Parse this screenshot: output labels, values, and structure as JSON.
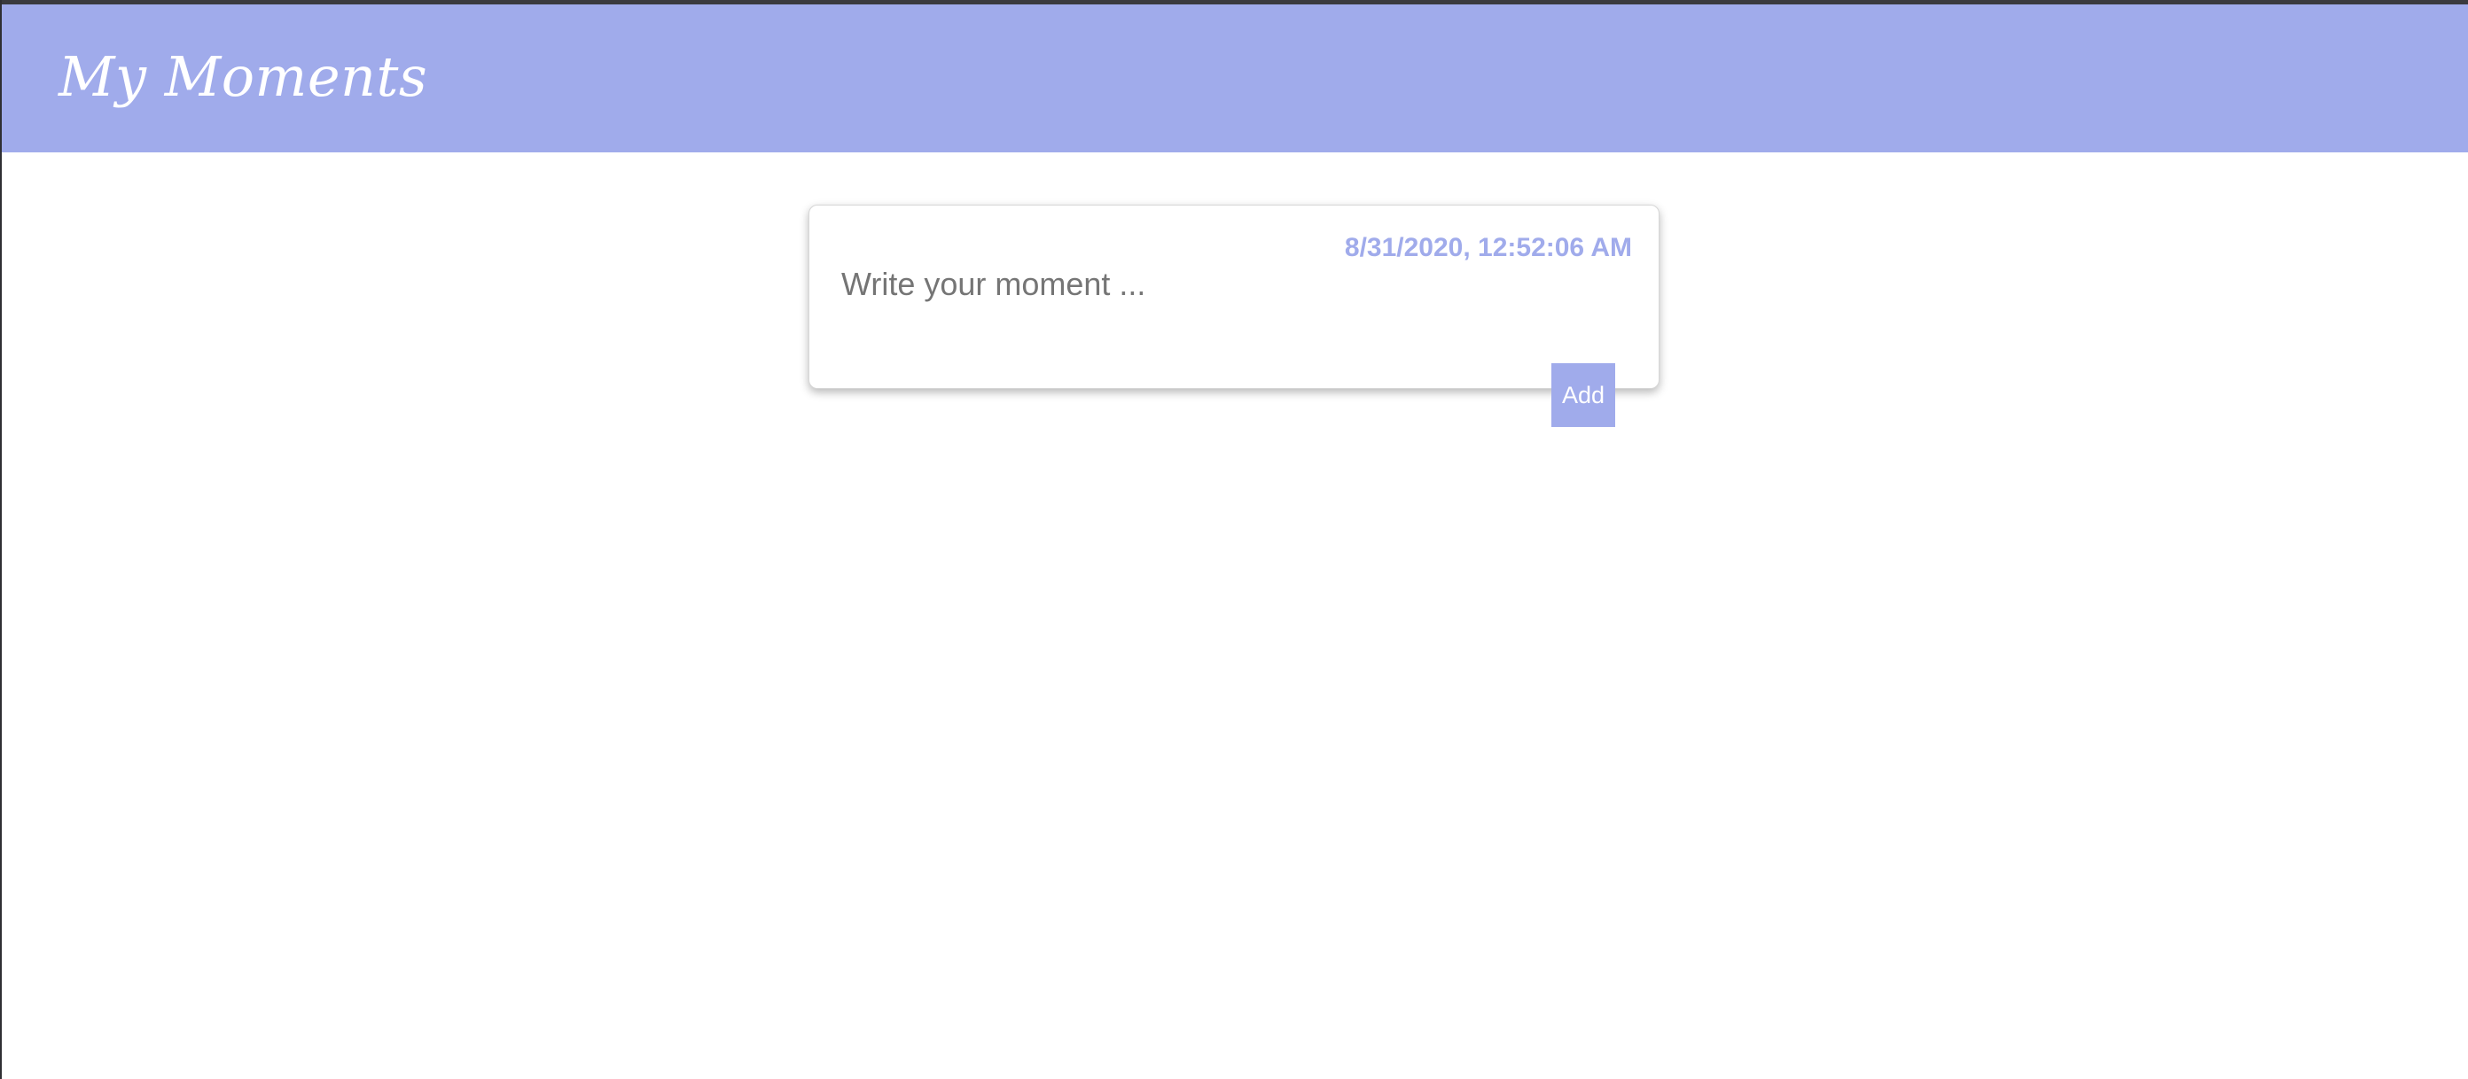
{
  "app": {
    "title": "My Moments"
  },
  "composer": {
    "timestamp": "8/31/2020, 12:52:06 AM",
    "value": "",
    "placeholder": "Write your moment ...",
    "add_label": "Add"
  },
  "colors": {
    "accent": "#a0abeb",
    "header_text": "#ffffff",
    "placeholder_text": "#757575",
    "background": "#ffffff"
  }
}
